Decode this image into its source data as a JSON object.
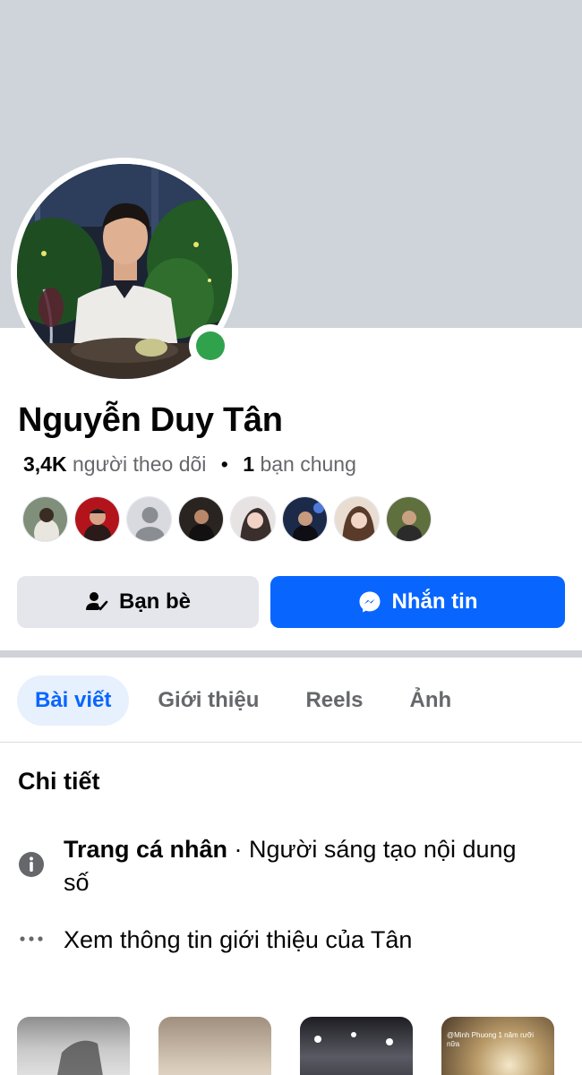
{
  "profile": {
    "name": "Nguyễn Duy Tân",
    "followers_count": "3,4K",
    "followers_label": "người theo dõi",
    "separator": "•",
    "mutual_count": "1",
    "mutual_label": "bạn chung",
    "online": true
  },
  "actions": {
    "friends_label": "Bạn bè",
    "message_label": "Nhắn tin"
  },
  "tabs": [
    {
      "label": "Bài viết",
      "active": true
    },
    {
      "label": "Giới thiệu",
      "active": false
    },
    {
      "label": "Reels",
      "active": false
    },
    {
      "label": "Ảnh",
      "active": false
    }
  ],
  "details": {
    "title": "Chi tiết",
    "page_type_bold": "Trang cá nhân",
    "page_type_rest": " · Người sáng tạo nội dung số",
    "see_about": "Xem thông tin giới thiệu của Tân"
  },
  "thumb_caption": "@Minh Phuong 1 năm rưỡi nữa",
  "colors": {
    "accent": "#0866ff",
    "online": "#31a24c",
    "cover": "#cfd4da",
    "secondary_text": "#65676b"
  }
}
